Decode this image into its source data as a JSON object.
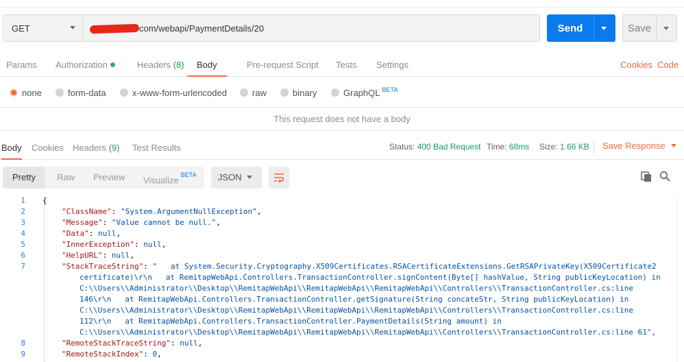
{
  "request": {
    "method": "GET",
    "url_visible": "com/webapi/PaymentDetails/20",
    "send_label": "Send",
    "save_label": "Save"
  },
  "request_tabs": {
    "params": "Params",
    "authorization": "Authorization",
    "headers": "Headers",
    "headers_count": "(8)",
    "body": "Body",
    "prerequest": "Pre-request Script",
    "tests": "Tests",
    "settings": "Settings",
    "cookies": "Cookies",
    "code": "Code"
  },
  "body_types": {
    "none": "none",
    "form_data": "form-data",
    "urlencoded": "x-www-form-urlencoded",
    "raw": "raw",
    "binary": "binary",
    "graphql": "GraphQL",
    "beta": "BETA"
  },
  "no_body_message": "This request does not have a body",
  "response_tabs": {
    "body": "Body",
    "cookies": "Cookies",
    "headers": "Headers",
    "headers_count": "(9)",
    "test_results": "Test Results"
  },
  "response_meta": {
    "status_label": "Status:",
    "status_value": "400 Bad Request",
    "time_label": "Time:",
    "time_value": "68ms",
    "size_label": "Size:",
    "size_value": "1.66 KB",
    "save_response": "Save Response"
  },
  "view_modes": {
    "pretty": "Pretty",
    "raw": "Raw",
    "preview": "Preview",
    "visualize": "Visualize",
    "beta": "BETA",
    "format": "JSON"
  },
  "code_lines": [
    {
      "n": "1",
      "text": "{"
    },
    {
      "n": "2",
      "key": "\"ClassName\"",
      "sep": ": ",
      "val": "\"System.ArgumentNullException\"",
      "end": ","
    },
    {
      "n": "3",
      "key": "\"Message\"",
      "sep": ": ",
      "val": "\"Value cannot be null.\"",
      "end": ","
    },
    {
      "n": "4",
      "key": "\"Data\"",
      "sep": ": ",
      "val": "null",
      "end": ","
    },
    {
      "n": "5",
      "key": "\"InnerException\"",
      "sep": ": ",
      "val": "null",
      "end": ","
    },
    {
      "n": "6",
      "key": "\"HelpURL\"",
      "sep": ": ",
      "val": "null",
      "end": ","
    },
    {
      "n": "7",
      "key": "\"StackTraceString\"",
      "sep": ": ",
      "val": "\"   at System.Security.Cryptography.X509Certificates.RSACertificateExtensions.GetRSAPrivateKey(X509Certificate2",
      "end": ""
    },
    {
      "n": "",
      "text": "certificate)\\r\\n   at RemitapWebApi.Controllers.TransactionController.signContent(Byte[] hashValue, String publicKeyLocation) in"
    },
    {
      "n": "",
      "text": "C:\\\\Users\\\\Administrator\\\\Desktop\\\\RemitapWebApi\\\\RemitapWebApi\\\\RemitapWebApi\\\\Controllers\\\\TransactionController.cs:line"
    },
    {
      "n": "",
      "text": "146\\r\\n   at RemitapWebApi.Controllers.TransactionController.getSignature(String concateStr, String publicKeyLocation) in"
    },
    {
      "n": "",
      "text": "C:\\\\Users\\\\Administrator\\\\Desktop\\\\RemitapWebApi\\\\RemitapWebApi\\\\RemitapWebApi\\\\Controllers\\\\TransactionController.cs:line"
    },
    {
      "n": "",
      "text": "112\\r\\n   at RemitapWebApi.Controllers.TransactionController.PaymentDetails(String amount) in"
    },
    {
      "n": "",
      "text": "C:\\\\Users\\\\Administrator\\\\Desktop\\\\RemitapWebApi\\\\RemitapWebApi\\\\RemitapWebApi\\\\Controllers\\\\TransactionController.cs:line 61\","
    },
    {
      "n": "8",
      "key": "\"RemoteStackTraceString\"",
      "sep": ": ",
      "val": "null",
      "end": ","
    },
    {
      "n": "9",
      "key": "\"RemoteStackIndex\"",
      "sep": ": ",
      "val": "0",
      "end": ","
    }
  ],
  "colors": {
    "accent": "#f26b3a",
    "send_blue": "#097bed",
    "status_green": "#1a9b5c",
    "json_key": "#a31515",
    "json_string": "#0451a5"
  },
  "icons": {
    "method_caret": "chevron-down-icon",
    "wrap": "wrap-lines-icon",
    "copy": "copy-icon",
    "search": "search-icon"
  }
}
